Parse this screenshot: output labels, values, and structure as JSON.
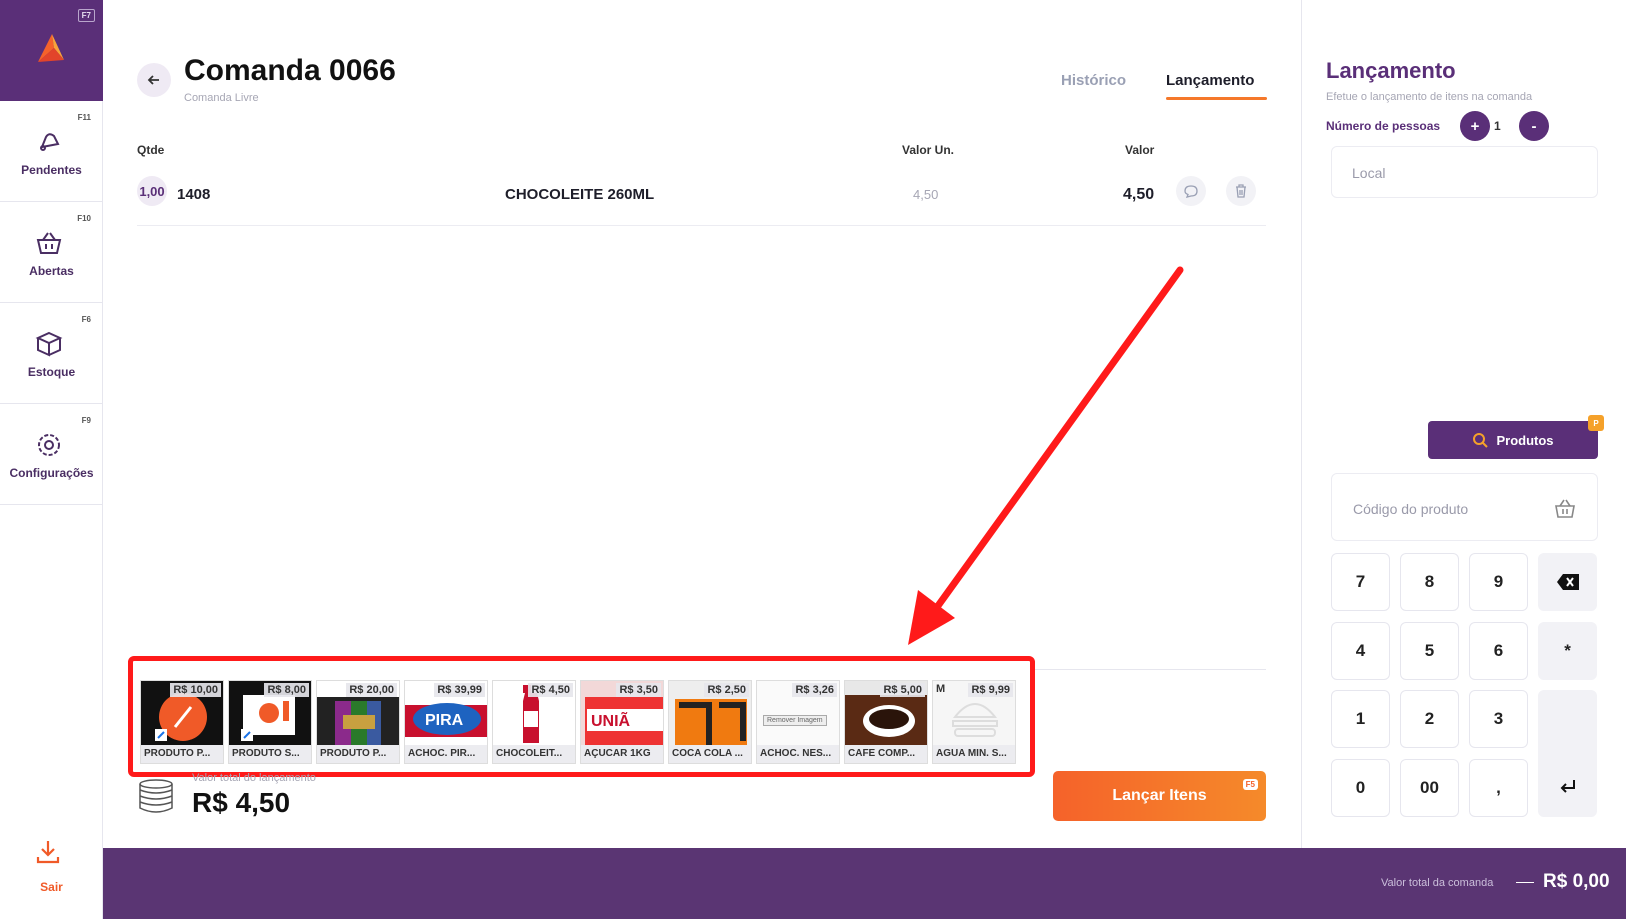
{
  "sidebar": {
    "logo_fkey": "F7",
    "items": [
      {
        "label": "Pendentes",
        "fkey": "F11"
      },
      {
        "label": "Abertas",
        "fkey": "F10"
      },
      {
        "label": "Estoque",
        "fkey": "F6"
      },
      {
        "label": "Configurações",
        "fkey": "F9"
      }
    ],
    "exit_label": "Sair"
  },
  "header": {
    "title": "Comanda 0066",
    "subtitle": "Comanda Livre",
    "tabs": [
      {
        "label": "Histórico",
        "active": false
      },
      {
        "label": "Lançamento",
        "active": true
      }
    ]
  },
  "table": {
    "columns": {
      "qty": "Qtde",
      "unit": "Valor Un.",
      "value": "Valor"
    },
    "rows": [
      {
        "qty": "1,00",
        "code": "1408",
        "description": "CHOCOLEITE 260ML",
        "unit_value": "4,50",
        "value": "4,50"
      }
    ]
  },
  "products": [
    {
      "name": "PRODUTO P...",
      "price": "R$ 10,00",
      "extra": ""
    },
    {
      "name": "PRODUTO S...",
      "price": "R$ 8,00",
      "extra": ""
    },
    {
      "name": "PRODUTO P...",
      "price": "R$ 20,00",
      "extra": ""
    },
    {
      "name": "ACHOC. PIR...",
      "price": "R$ 39,99",
      "extra": ""
    },
    {
      "name": "CHOCOLEIT...",
      "price": "R$ 4,50",
      "extra": ""
    },
    {
      "name": "AÇUCAR 1KG",
      "price": "R$ 3,50",
      "extra": ""
    },
    {
      "name": "COCA COLA ...",
      "price": "R$ 2,50",
      "extra": ""
    },
    {
      "name": "ACHOC. NES...",
      "price": "R$ 3,26",
      "extra": "Remover Imagem"
    },
    {
      "name": "CAFE COMP...",
      "price": "R$ 5,00",
      "extra": ""
    },
    {
      "name": "AGUA MIN. S...",
      "price": "R$ 9,99",
      "extra": "M"
    }
  ],
  "totals": {
    "label": "Valor total do lançamento",
    "value": "R$ 4,50",
    "launch_button": "Lançar Itens",
    "launch_fkey": "F5"
  },
  "panel": {
    "title": "Lançamento",
    "subtitle": "Efetue o lançamento de itens na comanda",
    "people_label": "Número de pessoas",
    "people_count": "1",
    "plus": "+",
    "minus": "-",
    "local_placeholder": "Local",
    "products_button": "Produtos",
    "products_fkey": "P",
    "code_placeholder": "Código do produto",
    "keypad": [
      "7",
      "8",
      "9",
      "4",
      "5",
      "6",
      "*",
      "1",
      "2",
      "3",
      "0",
      "00",
      ","
    ]
  },
  "footer": {
    "label": "Valor total da comanda",
    "value": "R$ 0,00"
  },
  "colors": {
    "brand_purple": "#5a2f78",
    "accent_orange": "#f5622a",
    "highlight_red": "#ff1a1a"
  }
}
